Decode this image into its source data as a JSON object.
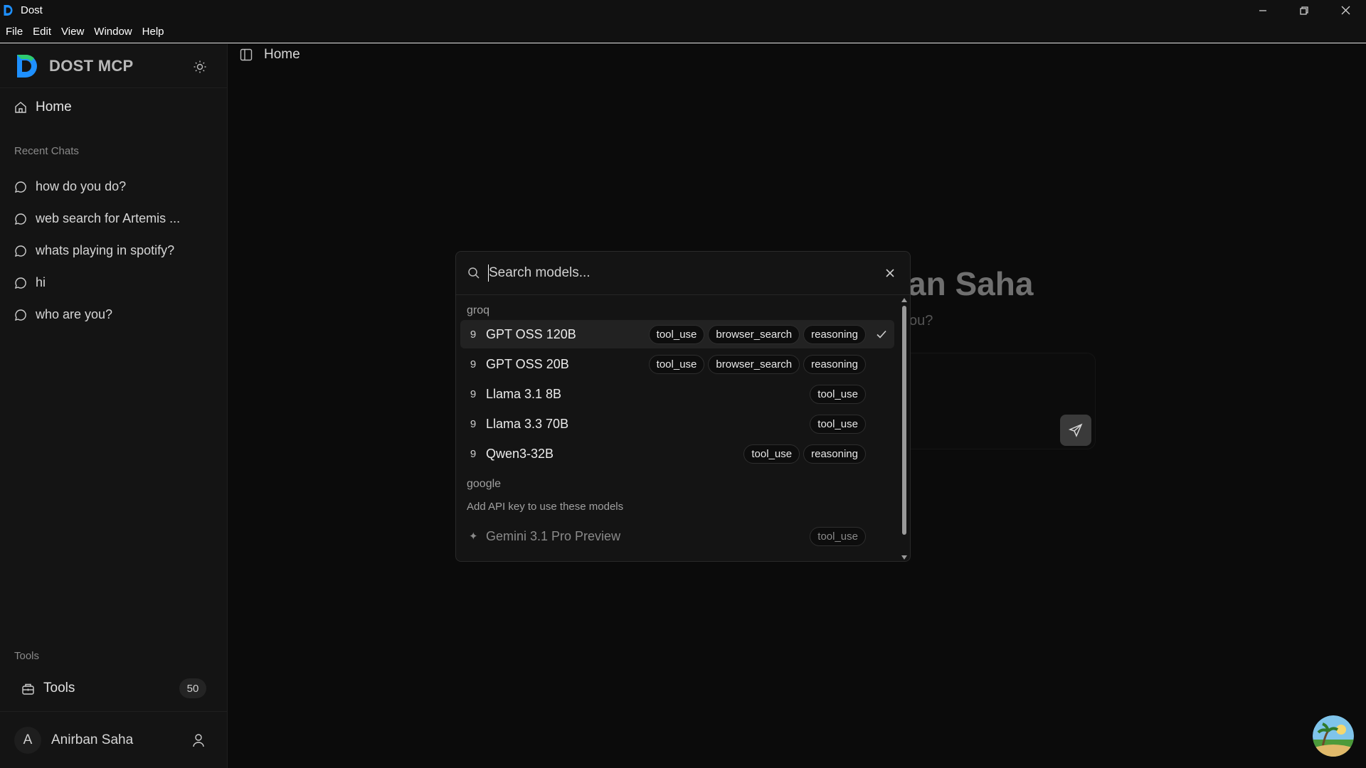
{
  "window": {
    "title": "Dost"
  },
  "menu": [
    "File",
    "Edit",
    "View",
    "Window",
    "Help"
  ],
  "sidebar": {
    "brand": "DOST MCP",
    "home_label": "Home",
    "recent_label": "Recent Chats",
    "chats": [
      "how do you do?",
      "web search for Artemis ...",
      "whats playing in spotify?",
      "hi",
      "who are you?"
    ],
    "tools_section_label": "Tools",
    "tools_label": "Tools",
    "tools_count": "50",
    "user_initial": "A",
    "user_name": "Anirban Saha"
  },
  "main": {
    "page_title": "Home",
    "greeting_fragment": "an Saha",
    "subtitle_fragment": "ou?"
  },
  "model_picker": {
    "search_placeholder": "Search models...",
    "search_value": "",
    "groups": [
      {
        "name": "groq",
        "models": [
          {
            "icon_glyph": "9",
            "name": "GPT OSS 120B",
            "tags": [
              "tool_use",
              "browser_search",
              "reasoning"
            ],
            "selected": true
          },
          {
            "icon_glyph": "9",
            "name": "GPT OSS 20B",
            "tags": [
              "tool_use",
              "browser_search",
              "reasoning"
            ],
            "selected": false
          },
          {
            "icon_glyph": "9",
            "name": "Llama 3.1 8B",
            "tags": [
              "tool_use"
            ],
            "selected": false
          },
          {
            "icon_glyph": "9",
            "name": "Llama 3.3 70B",
            "tags": [
              "tool_use"
            ],
            "selected": false
          },
          {
            "icon_glyph": "9",
            "name": "Qwen3-32B",
            "tags": [
              "tool_use",
              "reasoning"
            ],
            "selected": false
          }
        ]
      },
      {
        "name": "google",
        "note": "Add API key to use these models",
        "models": [
          {
            "icon_glyph": "✦",
            "name": "Gemini 3.1 Pro Preview",
            "tags": [
              "tool_use"
            ],
            "selected": false,
            "disabled": true
          }
        ]
      }
    ]
  },
  "colors": {
    "background": "#0b0b0b",
    "sidebar": "#141414",
    "modal": "#141414",
    "selected_row": "#222222",
    "accent_logo_blue": "#1e90ff",
    "accent_logo_green": "#2ecc71"
  },
  "icons": {
    "home": "home-icon",
    "chat": "chat-bubble-icon",
    "theme": "sun-icon",
    "sidebar_toggle": "sidebar-toggle-icon",
    "search": "search-icon",
    "close": "close-icon",
    "check": "check-icon",
    "tools": "toolbox-icon",
    "user": "user-icon",
    "send": "send-icon"
  }
}
